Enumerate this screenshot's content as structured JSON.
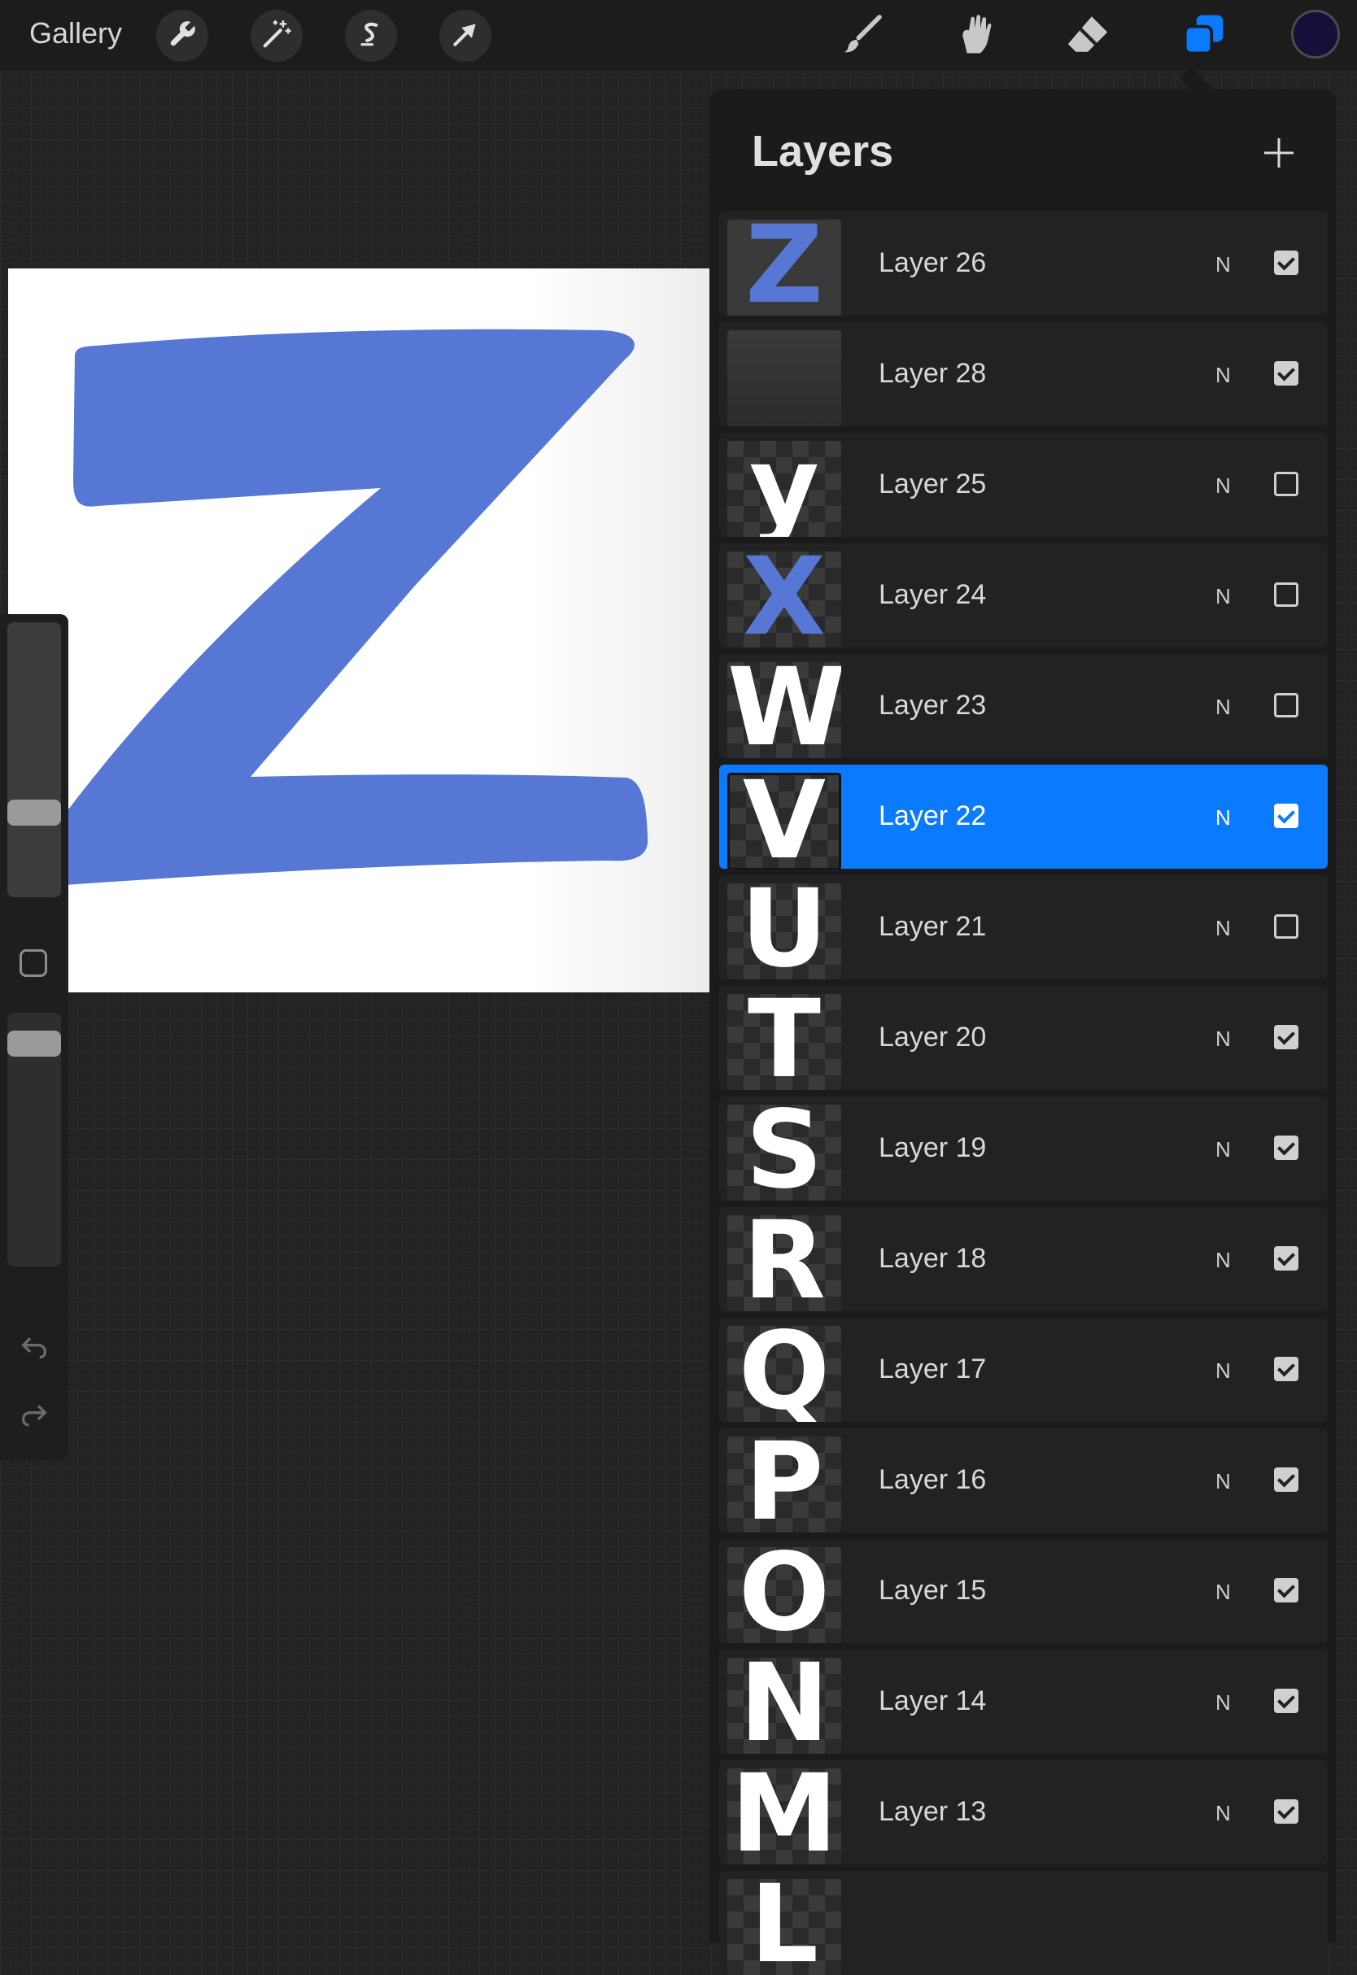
{
  "topbar": {
    "gallery_label": "Gallery",
    "actions": [
      "wrench-icon",
      "magic-wand-icon",
      "selection-s-icon",
      "transform-arrow-icon"
    ],
    "tools": [
      "brush-icon",
      "smudge-icon",
      "eraser-icon",
      "layers-icon"
    ],
    "active_tool": "layers-icon",
    "current_color": "#14103a"
  },
  "canvas": {
    "background": "#ffffff",
    "letter_color": "#5678d4"
  },
  "sidebar": {
    "size_slider_level": 0.66,
    "opacity_slider_level": 0.84,
    "undo_icon": "undo-icon",
    "redo_icon": "redo-icon"
  },
  "layers_panel": {
    "title": "Layers",
    "add_icon": "plus-icon",
    "accent": "#0a7aff",
    "layers": [
      {
        "name": "Layer 26",
        "blend": "N",
        "visible": true,
        "glyph": "Z",
        "thumb": "blue-z"
      },
      {
        "name": "Layer 28",
        "blend": "N",
        "visible": true,
        "glyph": "",
        "thumb": "dark"
      },
      {
        "name": "Layer 25",
        "blend": "N",
        "visible": false,
        "glyph": "y",
        "thumb": "white"
      },
      {
        "name": "Layer 24",
        "blend": "N",
        "visible": false,
        "glyph": "X",
        "thumb": "blue"
      },
      {
        "name": "Layer 23",
        "blend": "N",
        "visible": false,
        "glyph": "W",
        "thumb": "white"
      },
      {
        "name": "Layer 22",
        "blend": "N",
        "visible": true,
        "glyph": "V",
        "thumb": "white",
        "selected": true
      },
      {
        "name": "Layer 21",
        "blend": "N",
        "visible": false,
        "glyph": "U",
        "thumb": "white"
      },
      {
        "name": "Layer 20",
        "blend": "N",
        "visible": true,
        "glyph": "T",
        "thumb": "white"
      },
      {
        "name": "Layer 19",
        "blend": "N",
        "visible": true,
        "glyph": "S",
        "thumb": "white"
      },
      {
        "name": "Layer 18",
        "blend": "N",
        "visible": true,
        "glyph": "R",
        "thumb": "white"
      },
      {
        "name": "Layer 17",
        "blend": "N",
        "visible": true,
        "glyph": "Q",
        "thumb": "white"
      },
      {
        "name": "Layer 16",
        "blend": "N",
        "visible": true,
        "glyph": "P",
        "thumb": "white"
      },
      {
        "name": "Layer 15",
        "blend": "N",
        "visible": true,
        "glyph": "O",
        "thumb": "white"
      },
      {
        "name": "Layer 14",
        "blend": "N",
        "visible": true,
        "glyph": "N",
        "thumb": "white"
      },
      {
        "name": "Layer 13",
        "blend": "N",
        "visible": true,
        "glyph": "M",
        "thumb": "white"
      },
      {
        "name": "",
        "blend": "",
        "visible": null,
        "glyph": "L",
        "thumb": "white"
      }
    ]
  }
}
